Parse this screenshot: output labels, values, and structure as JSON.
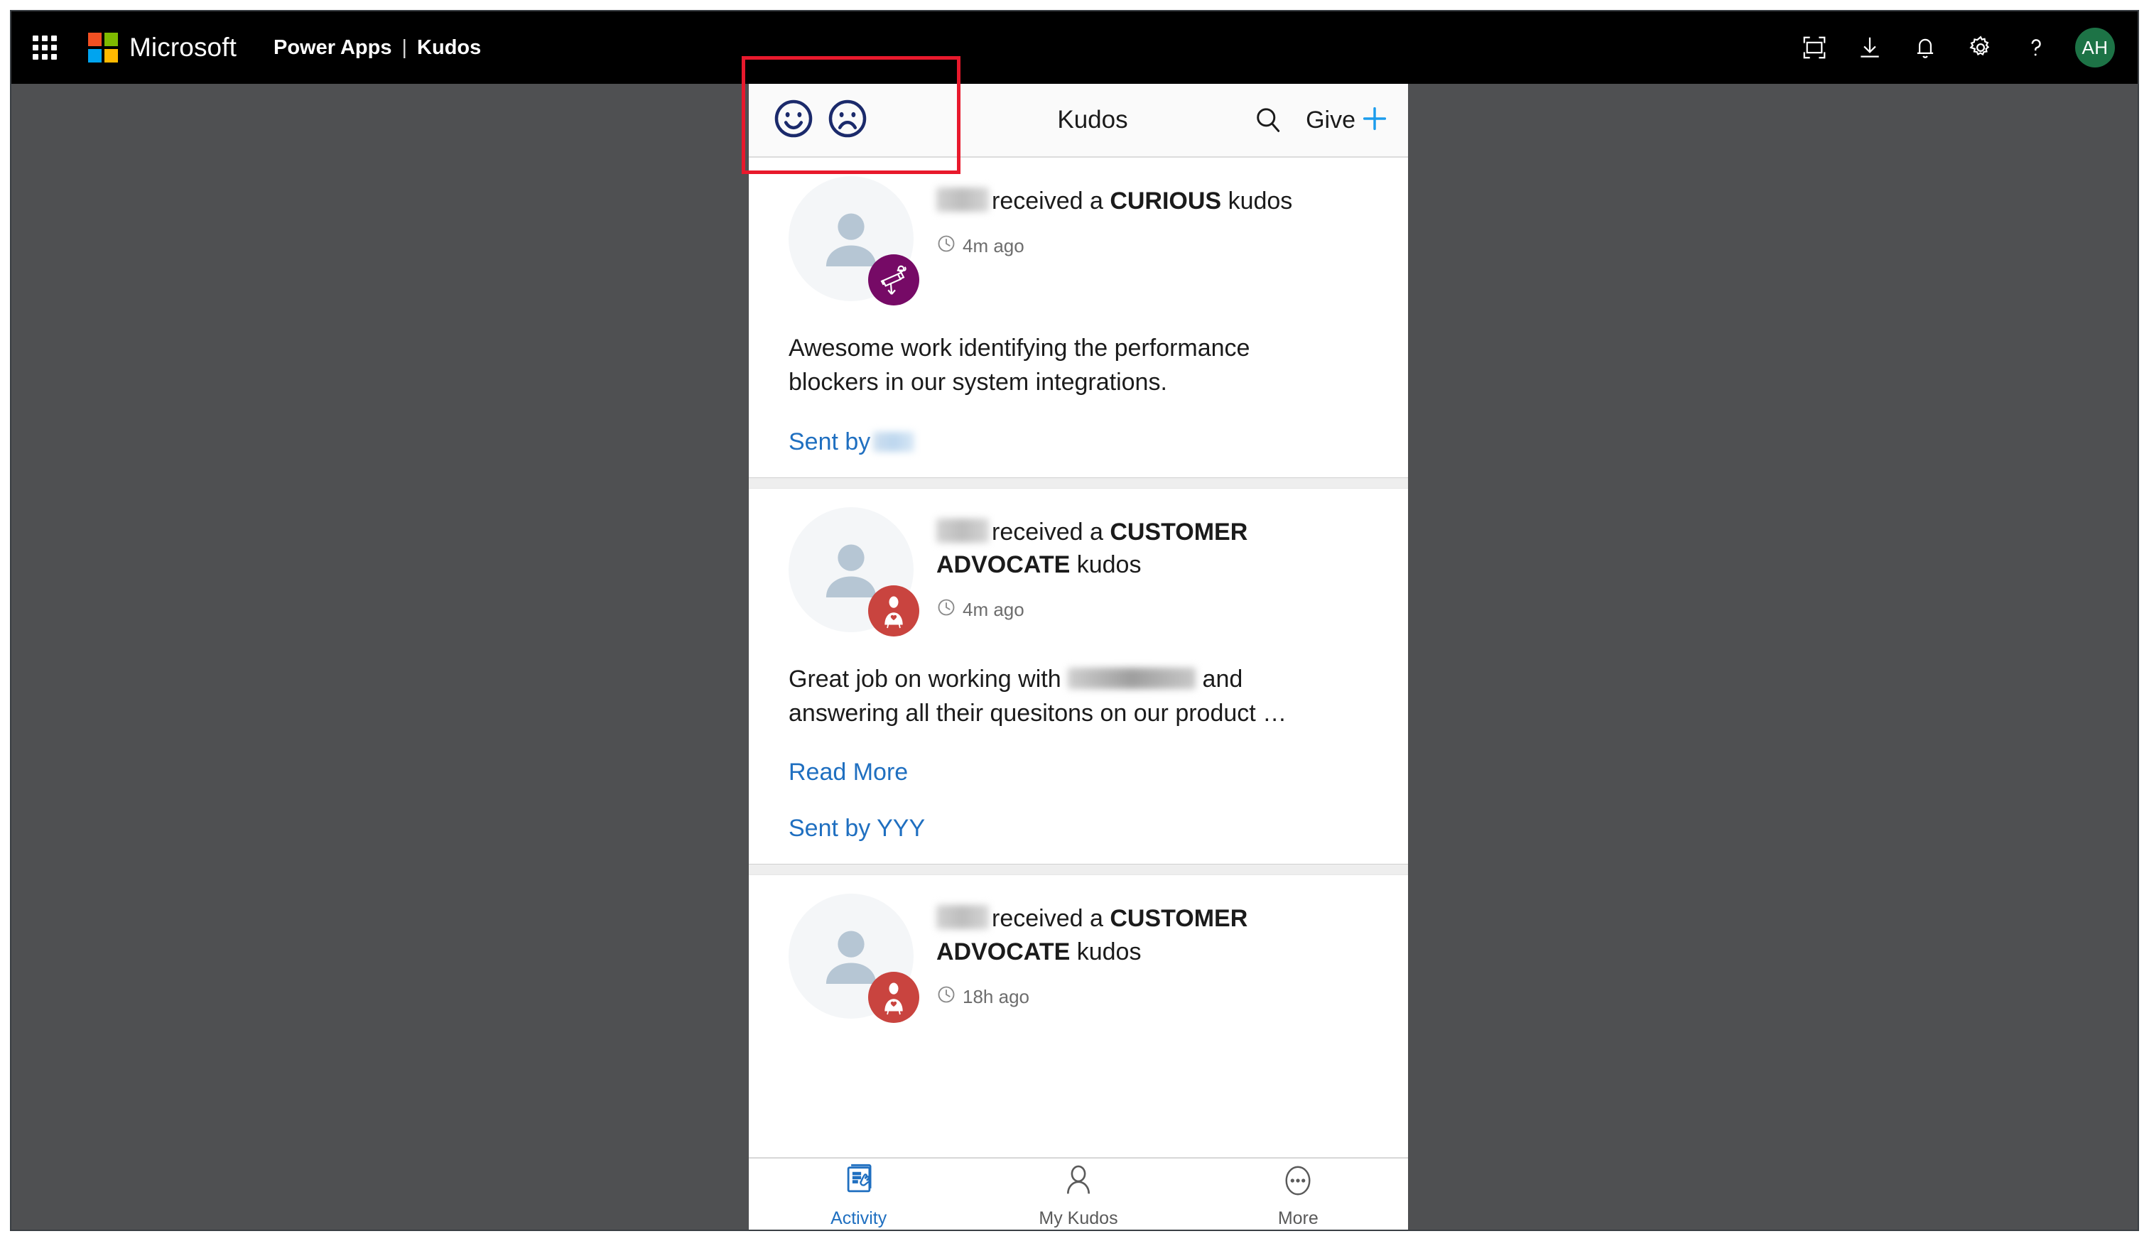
{
  "suite_bar": {
    "waffle_icon": "app-launcher-icon",
    "brand": "Microsoft",
    "app_name": "Power Apps",
    "separator": "|",
    "page_name": "Kudos",
    "right_icons": [
      {
        "name": "fullscreen-icon",
        "label": "Fullscreen"
      },
      {
        "name": "download-icon",
        "label": "Download"
      },
      {
        "name": "bell-icon",
        "label": "Notifications"
      },
      {
        "name": "gear-icon",
        "label": "Settings"
      },
      {
        "name": "help-icon",
        "label": "Help"
      }
    ],
    "avatar": {
      "initials": "AH",
      "color": "#1d7346"
    }
  },
  "app_header": {
    "mood_good_icon": "smiley-face-icon",
    "mood_bad_icon": "frowny-face-icon",
    "mood_icon_color": "#1b2a6b",
    "title": "Kudos",
    "search_icon": "search-icon",
    "give_label": "Give",
    "give_plus_icon": "plus-icon",
    "give_plus_color": "#1c9cec"
  },
  "feed": {
    "cards": [
      {
        "recipient_blurred": true,
        "received_text": "received a",
        "kudos_type": "CURIOUS",
        "kudos_suffix": "kudos",
        "time_icon": "clock-icon",
        "time": "4m ago",
        "badge_icon": "telescope-icon",
        "badge_color": "#760a66",
        "body_before": "Awesome work identifying the performance blockers in our system integrations.",
        "body_blurred": false,
        "body_after": "",
        "read_more": null,
        "sent_by_label": "Sent by",
        "sent_by_name": "",
        "sent_by_blurred": true
      },
      {
        "recipient_blurred": true,
        "received_text": "received a",
        "kudos_type": "CUSTOMER ADVOCATE",
        "kudos_suffix": "kudos",
        "time_icon": "clock-icon",
        "time": "4m ago",
        "badge_icon": "customer-advocate-icon",
        "badge_color": "#c9443f",
        "body_before": "Great job on working with",
        "body_blurred": true,
        "body_after": "and answering all their quesitons on our product …",
        "read_more": "Read More",
        "sent_by_label": "Sent by YYY",
        "sent_by_name": "",
        "sent_by_blurred": false
      },
      {
        "recipient_blurred": true,
        "received_text": "received a",
        "kudos_type": "CUSTOMER ADVOCATE",
        "kudos_suffix": "kudos",
        "time_icon": "clock-icon",
        "time": "18h ago",
        "badge_icon": "customer-advocate-icon",
        "badge_color": "#c9443f",
        "body_before": "",
        "body_blurred": false,
        "body_after": "",
        "read_more": null,
        "sent_by_label": "",
        "sent_by_name": "",
        "sent_by_blurred": false
      }
    ]
  },
  "bottom_nav": {
    "items": [
      {
        "label": "Activity",
        "icon": "activity-feed-icon",
        "active": true
      },
      {
        "label": "My Kudos",
        "icon": "person-icon",
        "active": false
      },
      {
        "label": "More",
        "icon": "ellipsis-icon",
        "active": false
      }
    ],
    "active_color": "#1f6fc0"
  },
  "annotation": {
    "color": "#e8192c",
    "target": "mood-face-buttons"
  }
}
